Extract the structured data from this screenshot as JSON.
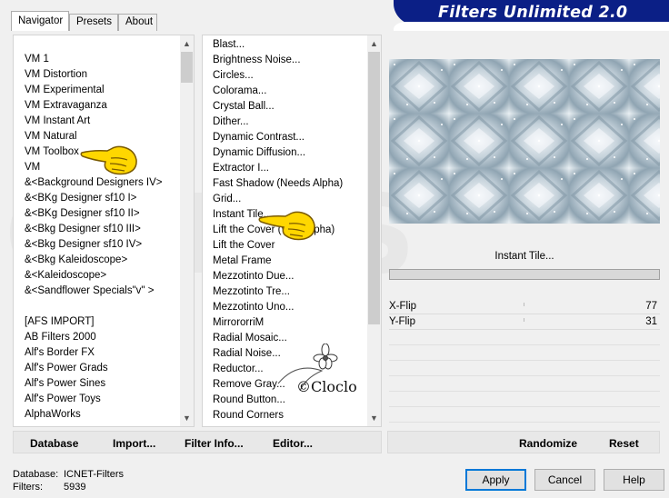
{
  "tabs": [
    "Navigator",
    "Presets",
    "About"
  ],
  "title": "Filters Unlimited 2.0",
  "categories": [
    "VM 1",
    "VM Distortion",
    "VM Experimental",
    "VM Extravaganza",
    "VM Instant Art",
    "VM Natural",
    "VM Toolbox",
    "VM",
    "&<Background Designers IV>",
    "&<BKg Designer sf10 I>",
    "&<BKg Designer sf10 II>",
    "&<Bkg Designer sf10 III>",
    "&<Bkg Designer sf10 IV>",
    "&<Bkg Kaleidoscope>",
    "&<Kaleidoscope>",
    "&<Sandflower Specials\"v\" >",
    "",
    "[AFS IMPORT]",
    "AB Filters 2000",
    "Alf's Border FX",
    "Alf's Power Grads",
    "Alf's Power Sines",
    "Alf's Power Toys",
    "AlphaWorks"
  ],
  "filters": [
    "Blast...",
    "Brightness Noise...",
    "Circles...",
    "Colorama...",
    "Crystal Ball...",
    "Dither...",
    "Dynamic Contrast...",
    "Dynamic Diffusion...",
    "Extractor I...",
    "Fast Shadow (Needs Alpha)",
    "Grid...",
    "Instant Tile...",
    "Lift the Cover (With Alpha)",
    "Lift the Cover",
    "Metal Frame",
    "Mezzotinto Due...",
    "Mezzotinto Tre...",
    "Mezzotinto Uno...",
    "MirrororriM",
    "Radial Mosaic...",
    "Radial Noise...",
    "Reductor...",
    "Remove Gray...",
    "Round Button...",
    "Round Corners"
  ],
  "selected_filter": "Instant Tile...",
  "params": [
    {
      "label": "X-Flip",
      "value": "77"
    },
    {
      "label": "Y-Flip",
      "value": "31"
    }
  ],
  "toolbar": {
    "database": "Database",
    "import": "Import...",
    "filter_info": "Filter Info...",
    "editor": "Editor...",
    "randomize": "Randomize",
    "reset": "Reset"
  },
  "status": {
    "database_label": "Database:",
    "database_value": "ICNET-Filters",
    "filters_label": "Filters:",
    "filters_value": "5939"
  },
  "buttons": {
    "apply": "Apply",
    "cancel": "Cancel",
    "help": "Help"
  },
  "watermark": {
    "signature": "©Cloclo"
  },
  "colors": {
    "banner": "#0b1f86",
    "accent": "#0078d7",
    "hand": "#ffd700"
  }
}
